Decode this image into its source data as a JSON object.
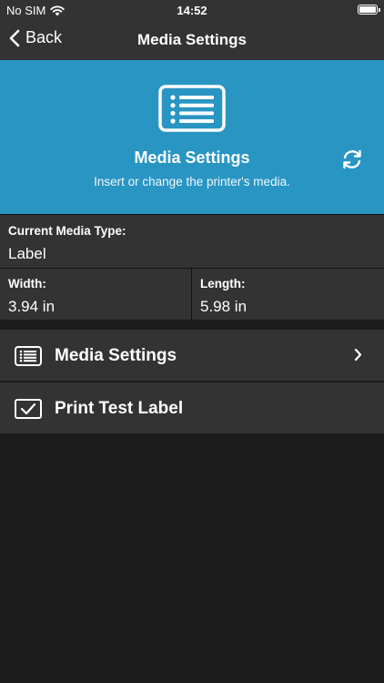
{
  "status_bar": {
    "carrier": "No SIM",
    "time": "14:52"
  },
  "nav": {
    "back_label": "Back",
    "title": "Media Settings"
  },
  "hero": {
    "title": "Media Settings",
    "subtitle": "Insert or change the printer's media."
  },
  "media": {
    "type_label": "Current Media Type:",
    "type_value": "Label",
    "width_label": "Width:",
    "width_value": "3.94 in",
    "length_label": "Length:",
    "length_value": "5.98 in"
  },
  "menu": [
    {
      "label": "Media Settings",
      "icon": "list-icon"
    },
    {
      "label": "Print Test Label",
      "icon": "checkbox-icon"
    }
  ],
  "colors": {
    "accent": "#2895c3",
    "panel": "#333333",
    "background": "#1c1c1c"
  }
}
